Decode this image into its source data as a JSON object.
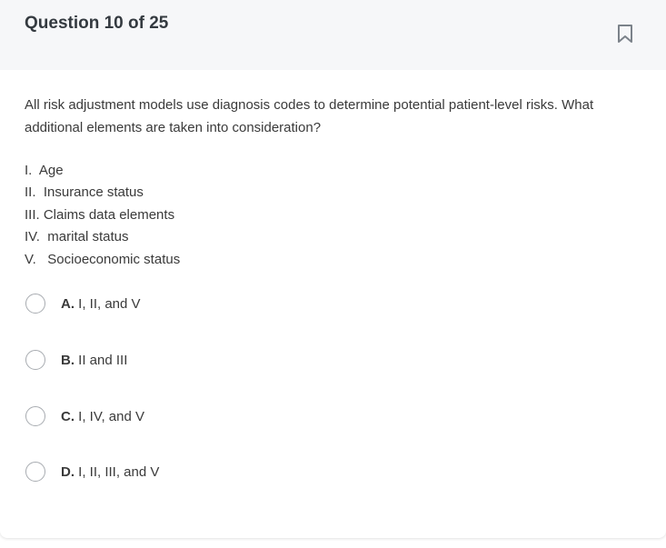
{
  "header": {
    "title": "Question 10 of 25",
    "bookmark_icon": "bookmark-icon"
  },
  "question": {
    "text": "All risk adjustment models use diagnosis codes to determine potential patient-level risks. What additional elements are taken into consideration?",
    "statements": [
      "I.  Age",
      "II.  Insurance status",
      "III. Claims data elements",
      "IV.  marital status",
      "V.   Socioeconomic status"
    ]
  },
  "options": [
    {
      "letter": "A.",
      "text": " I, II, and V"
    },
    {
      "letter": "B.",
      "text": " II and III"
    },
    {
      "letter": "C.",
      "text": " I, IV, and V"
    },
    {
      "letter": "D.",
      "text": " I, II, III, and V"
    }
  ],
  "colors": {
    "header_bg": "#f6f7f9",
    "radio_border": "#a7abb0",
    "text": "#3a3a3a"
  }
}
